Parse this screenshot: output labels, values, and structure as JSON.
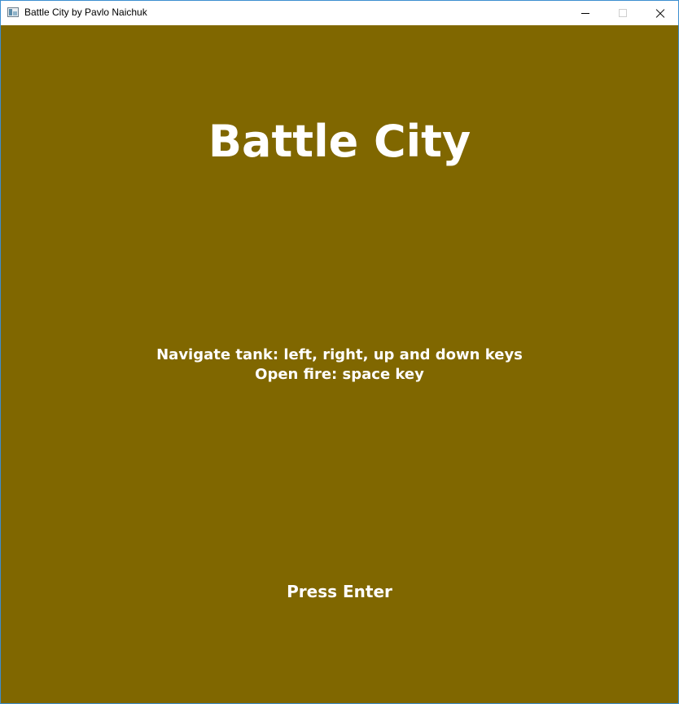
{
  "window": {
    "title": "Battle City by Pavlo Naichuk",
    "icon": "app-window-icon",
    "controls": [
      "minimize-icon",
      "maximize-icon",
      "close-icon"
    ]
  },
  "game": {
    "background_color": "#806700",
    "title": "Battle City",
    "instructions": [
      "Navigate tank: left, right, up and down keys",
      "Open fire: space key"
    ],
    "prompt": "Press Enter"
  }
}
